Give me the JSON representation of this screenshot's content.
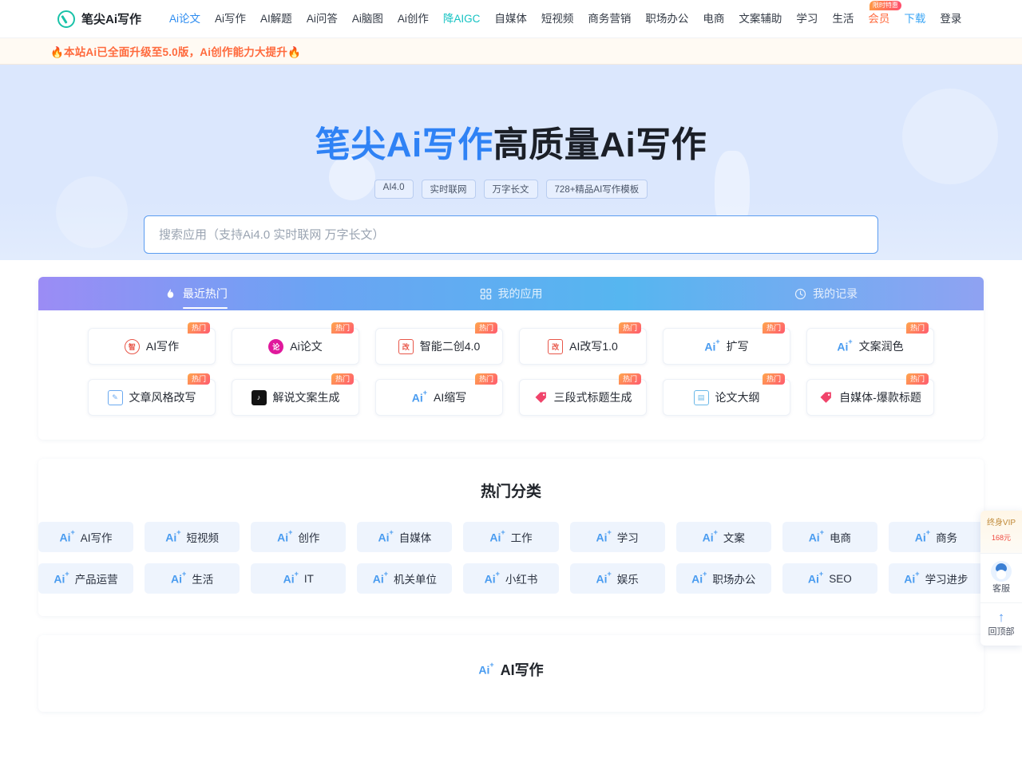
{
  "nav": {
    "logo_text": "笔尖Ai写作",
    "logo_icon": "pen-circle-icon",
    "links": [
      {
        "label": "Ai论文",
        "style": "accent"
      },
      {
        "label": "Ai写作",
        "style": "plain"
      },
      {
        "label": "AI解题",
        "style": "plain"
      },
      {
        "label": "Ai问答",
        "style": "plain"
      },
      {
        "label": "Ai脑图",
        "style": "plain"
      },
      {
        "label": "Ai创作",
        "style": "plain"
      },
      {
        "label": "降AIGC",
        "style": "cyan"
      },
      {
        "label": "自媒体",
        "style": "plain"
      },
      {
        "label": "短视频",
        "style": "plain"
      },
      {
        "label": "商务营销",
        "style": "plain"
      },
      {
        "label": "职场办公",
        "style": "plain"
      },
      {
        "label": "电商",
        "style": "plain"
      },
      {
        "label": "文案辅助",
        "style": "plain"
      },
      {
        "label": "学习",
        "style": "plain"
      },
      {
        "label": "生活",
        "style": "plain"
      },
      {
        "label": "会员",
        "style": "vip",
        "badge": "限时特惠"
      },
      {
        "label": "下载",
        "style": "dl"
      },
      {
        "label": "登录",
        "style": "plain"
      }
    ]
  },
  "notice": {
    "text": "🔥本站Ai已全面升级至5.0版，Ai创作能力大提升🔥"
  },
  "hero": {
    "title_blue": "笔尖Ai写作",
    "title_dark": "高质量Ai写作",
    "tags": [
      "AI4.0",
      "实时联网",
      "万字长文",
      "728+精品AI写作模板"
    ]
  },
  "search": {
    "placeholder": "搜索应用（支持Ai4.0 实时联网 万字长文）",
    "value": ""
  },
  "tabs": [
    {
      "label": "最近热门",
      "icon": "flame-icon",
      "active": true
    },
    {
      "label": "我的应用",
      "icon": "grid-icon",
      "active": false
    },
    {
      "label": "我的记录",
      "icon": "clock-icon",
      "active": false
    }
  ],
  "apps": {
    "hot_badge": "热门",
    "rows": [
      [
        {
          "name": "AI写作",
          "icon": "seal-icon",
          "icon_type": "circle",
          "glyph": "智",
          "color": "#e8574a"
        },
        {
          "name": "Ai论文",
          "icon": "thesis-icon",
          "icon_type": "dot",
          "glyph": "论",
          "color": "#e0189c"
        },
        {
          "name": "智能二创4.0",
          "icon": "rewrite-icon",
          "icon_type": "square",
          "glyph": "改",
          "color": "#e8574a"
        },
        {
          "name": "AI改写1.0",
          "icon": "rewrite-icon",
          "icon_type": "square",
          "glyph": "改",
          "color": "#e8574a"
        },
        {
          "name": "扩写",
          "icon": "ai-plus-icon",
          "icon_type": "ai",
          "glyph": "Ai",
          "color": "#4a9cf0"
        },
        {
          "name": "文案润色",
          "icon": "ai-plus-icon",
          "icon_type": "ai",
          "glyph": "Ai",
          "color": "#4a9cf0"
        }
      ],
      [
        {
          "name": "文章风格改写",
          "icon": "edit-note-icon",
          "icon_type": "square",
          "glyph": "✎",
          "color": "#6aa9f0"
        },
        {
          "name": "解说文案生成",
          "icon": "tiktok-icon",
          "icon_type": "square",
          "glyph": "♪",
          "color": "#121212"
        },
        {
          "name": "AI缩写",
          "icon": "ai-plus-icon",
          "icon_type": "ai",
          "glyph": "Ai",
          "color": "#4a9cf0"
        },
        {
          "name": "三段式标题生成",
          "icon": "tag-icon",
          "icon_type": "tag",
          "glyph": "🏷",
          "color": "#f0436a"
        },
        {
          "name": "论文大纲",
          "icon": "clipboard-icon",
          "icon_type": "square",
          "glyph": "▤",
          "color": "#6ab8e8"
        },
        {
          "name": "自媒体-爆款标题",
          "icon": "tag-icon",
          "icon_type": "tag",
          "glyph": "🏷",
          "color": "#f0436a"
        }
      ]
    ]
  },
  "categories": {
    "title": "热门分类",
    "icon": "ai-plus-icon",
    "rows": [
      [
        "AI写作",
        "短视频",
        "创作",
        "自媒体",
        "工作",
        "学习",
        "文案",
        "电商",
        "商务"
      ],
      [
        "产品运营",
        "生活",
        "IT",
        "机关单位",
        "小红书",
        "娱乐",
        "职场办公",
        "SEO",
        "学习进步"
      ]
    ]
  },
  "bottom_section": {
    "title": "AI写作",
    "icon": "ai-plus-icon"
  },
  "floatbar": {
    "vip_label": "终身VIP",
    "vip_price": "168",
    "vip_unit": "元",
    "service_label": "客服",
    "service_icon": "headset-avatar-icon",
    "top_label": "回顶部",
    "top_icon": "arrow-up-icon"
  },
  "colors": {
    "accent": "#2f82f5",
    "brand": "#19c2a8",
    "hot": "#ff5a6e",
    "vip": "#ff6a3d",
    "hero_bg": "#dbe7fd"
  }
}
